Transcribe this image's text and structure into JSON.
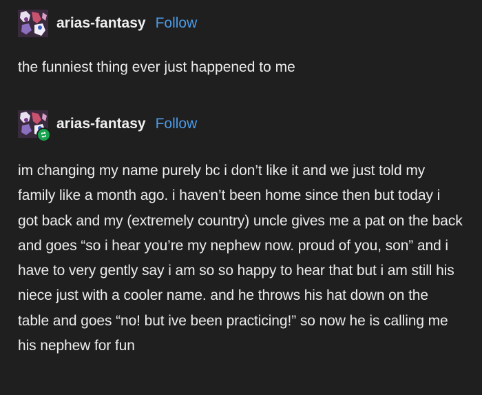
{
  "posts": [
    {
      "username": "arias-fantasy",
      "follow_label": "Follow",
      "avatar_icon": "anime-character-avatar",
      "text": "the funniest thing ever just happened to me"
    },
    {
      "username": "arias-fantasy",
      "follow_label": "Follow",
      "avatar_icon": "anime-character-avatar",
      "badge_icon": "reblog-icon",
      "text": "im changing my name purely bc i don’t like it and we just told my family like a month ago. i haven’t been home since then but today i got back and my (extremely country) uncle gives me a pat on the back and goes “so i hear you’re my nephew now. proud of you, son” and i have to very gently say i am so so happy to hear that but i am still his niece just with a cooler name. and he throws his hat down on the table and goes “no! but ive been practicing!” so now he is calling me his nephew for fun"
    }
  ],
  "colors": {
    "background": "#1f1f1f",
    "text": "#ececec",
    "follow": "#4d9be8",
    "reblog_badge": "#19a34f"
  }
}
